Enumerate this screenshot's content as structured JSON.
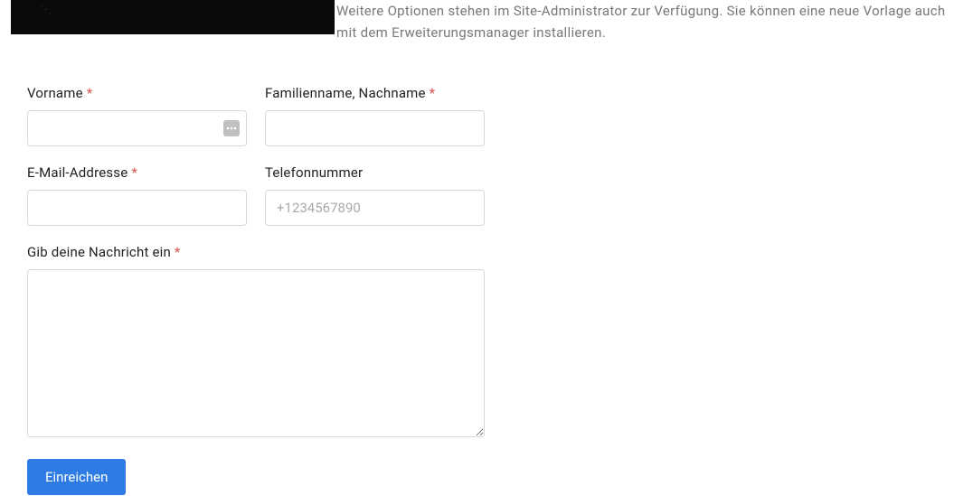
{
  "description": "Weitere Optionen stehen im Site-Administrator zur Verfügung. Sie können eine neue Vorlage auch mit dem Erweiterungsmanager installieren.",
  "form": {
    "first_name_label": "Vorname",
    "last_name_label": "Familienname, Nachname",
    "email_label": "E-Mail-Addresse",
    "phone_label": "Telefonnummer",
    "phone_placeholder": "+1234567890",
    "message_label": "Gib deine Nachricht ein",
    "submit_label": "Einreichen",
    "required_mark": "*"
  }
}
